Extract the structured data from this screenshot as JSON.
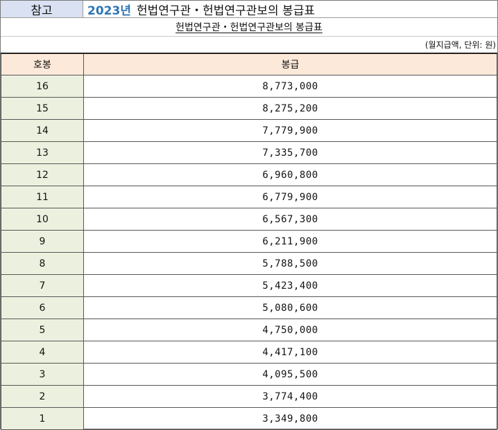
{
  "header": {
    "tag": "참고",
    "year": "2023년",
    "title": "헌법연구관・헌법연구관보의 봉급표"
  },
  "subtitle": "헌법연구관・헌법연구관보의 봉급표",
  "unit_note": "(월지급액, 단위: 원)",
  "table": {
    "columns": [
      "호봉",
      "봉급"
    ],
    "rows": [
      {
        "grade": "16",
        "pay": "8,773,000"
      },
      {
        "grade": "15",
        "pay": "8,275,200"
      },
      {
        "grade": "14",
        "pay": "7,779,900"
      },
      {
        "grade": "13",
        "pay": "7,335,700"
      },
      {
        "grade": "12",
        "pay": "6,960,800"
      },
      {
        "grade": "11",
        "pay": "6,779,900"
      },
      {
        "grade": "10",
        "pay": "6,567,300"
      },
      {
        "grade": "9",
        "pay": "6,211,900"
      },
      {
        "grade": "8",
        "pay": "5,788,500"
      },
      {
        "grade": "7",
        "pay": "5,423,400"
      },
      {
        "grade": "6",
        "pay": "5,080,600"
      },
      {
        "grade": "5",
        "pay": "4,750,000"
      },
      {
        "grade": "4",
        "pay": "4,417,100"
      },
      {
        "grade": "3",
        "pay": "4,095,500"
      },
      {
        "grade": "2",
        "pay": "3,774,400"
      },
      {
        "grade": "1",
        "pay": "3,349,800"
      }
    ]
  }
}
